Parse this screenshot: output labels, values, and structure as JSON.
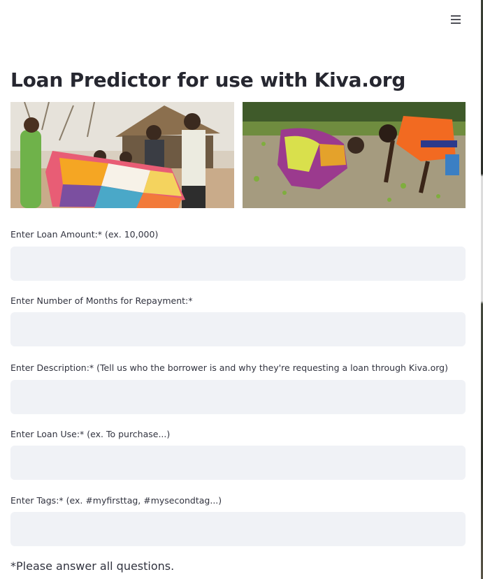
{
  "header": {
    "menu_icon": "hamburger-menu-icon"
  },
  "page": {
    "title": "Loan Predictor for use with Kiva.org"
  },
  "images": [
    {
      "name": "women-holding-quilt-photo"
    },
    {
      "name": "farmers-planting-field-photo"
    }
  ],
  "form": {
    "fields": [
      {
        "label": "Enter Loan Amount:* (ex. 10,000)",
        "value": ""
      },
      {
        "label": "Enter Number of Months for Repayment:*",
        "value": ""
      },
      {
        "label": "Enter Description:* (Tell us who the borrower is and why they're requesting a loan through Kiva.org)",
        "value": ""
      },
      {
        "label": "Enter Loan Use:* (ex. To purchase...)",
        "value": ""
      },
      {
        "label": "Enter Tags:* (ex. #myfirsttag, #mysecondtag...)",
        "value": ""
      }
    ],
    "note": "*Please answer all questions."
  }
}
